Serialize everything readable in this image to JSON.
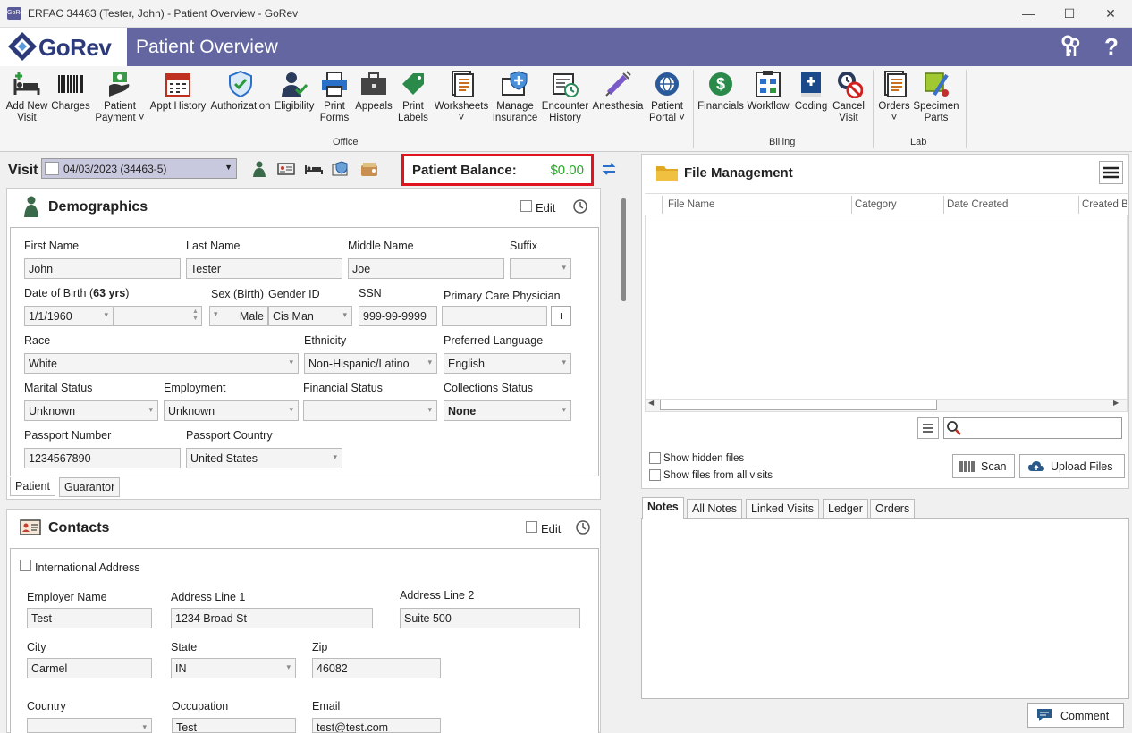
{
  "window": {
    "title": "ERFAC 34463 (Tester, John) - Patient Overview - GoRev",
    "app_icon_text": "GoRev"
  },
  "header": {
    "logo_text": "GoRev",
    "page_title": "Patient Overview",
    "key_icon": "key-icon",
    "help_icon": "?"
  },
  "ribbon": {
    "office": [
      {
        "label": "Add New\nVisit",
        "icon": "bed-plus-icon"
      },
      {
        "label": "Charges",
        "icon": "barcode-icon"
      },
      {
        "label": "Patient\nPayment ˅",
        "icon": "payment-hand-icon"
      },
      {
        "label": "Appt History",
        "icon": "calendar-icon"
      },
      {
        "label": "Authorization",
        "icon": "shield-check-icon"
      },
      {
        "label": "Eligibility",
        "icon": "person-check-icon"
      },
      {
        "label": "Print\nForms",
        "icon": "printer-icon"
      },
      {
        "label": "Appeals",
        "icon": "briefcase-icon"
      },
      {
        "label": "Print\nLabels",
        "icon": "tag-icon"
      },
      {
        "label": "Worksheets\n˅",
        "icon": "worksheet-icon"
      },
      {
        "label": "Manage\nInsurance",
        "icon": "insurance-icon"
      },
      {
        "label": "Encounter\nHistory",
        "icon": "encounter-icon"
      },
      {
        "label": "Anesthesia",
        "icon": "syringe-icon"
      },
      {
        "label": "Patient\nPortal ˅",
        "icon": "globe-gear-icon"
      }
    ],
    "billing": [
      {
        "label": "Financials",
        "icon": "dollar-icon"
      },
      {
        "label": "Workflow",
        "icon": "workflow-icon"
      },
      {
        "label": "Coding",
        "icon": "coding-book-icon"
      },
      {
        "label": "Cancel\nVisit",
        "icon": "cancel-visit-icon"
      }
    ],
    "lab": [
      {
        "label": "Orders\n˅",
        "icon": "orders-icon"
      },
      {
        "label": "Specimen\nParts",
        "icon": "specimen-icon"
      }
    ],
    "groups": {
      "office": "Office",
      "billing": "Billing",
      "lab": "Lab"
    }
  },
  "visit": {
    "label": "Visit",
    "selected": "04/03/2023 (34463-5)"
  },
  "balance": {
    "label": "Patient Balance:",
    "value": "$0.00"
  },
  "demographics": {
    "title": "Demographics",
    "edit_label": "Edit",
    "first_name_lbl": "First Name",
    "first_name": "John",
    "last_name_lbl": "Last Name",
    "last_name": "Tester",
    "middle_name_lbl": "Middle Name",
    "middle_name": "Joe",
    "suffix_lbl": "Suffix",
    "suffix": "",
    "dob_lbl": "Date of Birth (",
    "dob_age": "63 yrs",
    "dob_close": ")",
    "dob": "1/1/1960",
    "sex_lbl": "Sex (Birth)",
    "sex": "Male",
    "gender_lbl": "Gender ID",
    "gender": "Cis Man",
    "ssn_lbl": "SSN",
    "ssn": "999-99-9999",
    "pcp_lbl": "Primary Care Physician",
    "pcp": "",
    "race_lbl": "Race",
    "race": "White",
    "ethnicity_lbl": "Ethnicity",
    "ethnicity": "Non-Hispanic/Latino",
    "language_lbl": "Preferred Language",
    "language": "English",
    "marital_lbl": "Marital Status",
    "marital": "Unknown",
    "employment_lbl": "Employment",
    "employment": "Unknown",
    "financial_lbl": "Financial Status",
    "financial": "",
    "collections_lbl": "Collections Status",
    "collections": "None",
    "passport_lbl": "Passport Number",
    "passport": "1234567890",
    "passport_country_lbl": "Passport Country",
    "passport_country": "United States",
    "tabs": [
      "Patient",
      "Guarantor"
    ]
  },
  "contacts": {
    "title": "Contacts",
    "edit_label": "Edit",
    "intl_lbl": "International Address",
    "employer_lbl": "Employer Name",
    "employer": "Test",
    "addr1_lbl": "Address Line 1",
    "addr1": "1234 Broad St",
    "addr2_lbl": "Address Line 2",
    "addr2": "Suite 500",
    "city_lbl": "City",
    "city": "Carmel",
    "state_lbl": "State",
    "state": "IN",
    "zip_lbl": "Zip",
    "zip": "46082",
    "country_lbl": "Country",
    "country": "",
    "occupation_lbl": "Occupation",
    "occupation": "Test",
    "email_lbl": "Email",
    "email": "test@test.com"
  },
  "files": {
    "title": "File Management",
    "columns": [
      "File Name",
      "Category",
      "Date Created",
      "Created B"
    ],
    "show_hidden": "Show hidden files",
    "show_all": "Show files from all visits",
    "scan": "Scan",
    "upload": "Upload Files",
    "search_placeholder": ""
  },
  "notes": {
    "tabs": [
      "Notes",
      "All Notes",
      "Linked Visits",
      "Ledger",
      "Orders"
    ],
    "comment": "Comment"
  }
}
